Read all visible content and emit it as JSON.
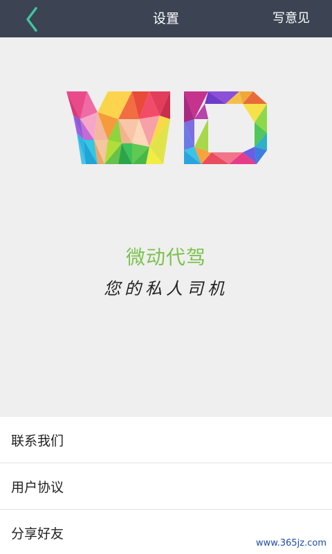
{
  "header": {
    "back_icon": "chevron-left-icon",
    "title": "设置",
    "feedback_label": "写意见"
  },
  "hero": {
    "logo_icon": "wd-logo",
    "brand_name": "微动代驾",
    "slogan": "您的私人司机"
  },
  "menu": {
    "items": [
      {
        "label": "联系我们"
      },
      {
        "label": "用户协议"
      },
      {
        "label": "分享好友"
      }
    ]
  },
  "watermark": "www.365jz.com",
  "colors": {
    "nav_bg": "#3c4453",
    "accent_green": "#7cc24d",
    "back_arrow": "#3fc6a0"
  }
}
